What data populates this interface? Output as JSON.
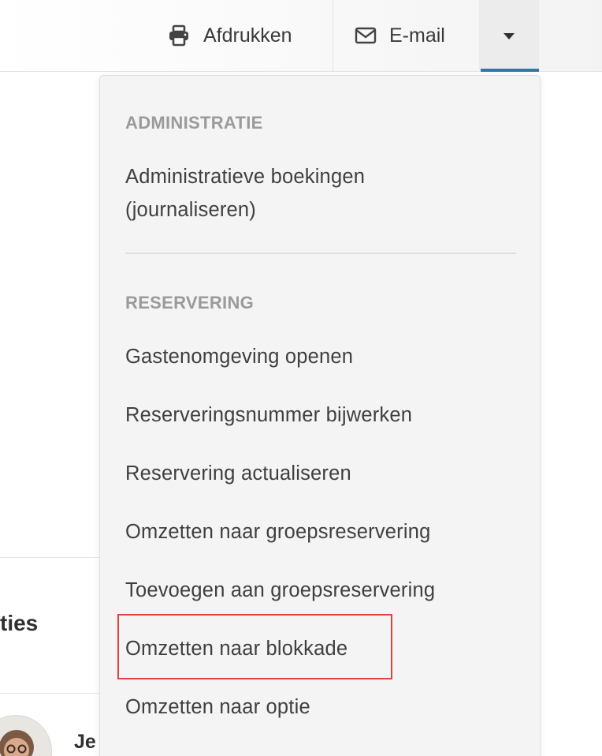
{
  "toolbar": {
    "print_label": "Afdrukken",
    "email_label": "E-mail"
  },
  "background": {
    "heading_fragment": "ties",
    "name_fragment": "Je"
  },
  "menu": {
    "sections": [
      {
        "title": "ADMINISTRATIE",
        "items": [
          {
            "label_line1": "Administratieve boekingen",
            "label_line2": "(journaliseren)"
          }
        ]
      },
      {
        "title": "RESERVERING",
        "items": [
          {
            "label": "Gastenomgeving openen"
          },
          {
            "label": "Reserveringsnummer bijwerken"
          },
          {
            "label": "Reservering actualiseren"
          },
          {
            "label": "Omzetten naar groepsreservering"
          },
          {
            "label": "Toevoegen aan groepsreservering"
          },
          {
            "label": "Omzetten naar blokkade",
            "highlighted": true
          },
          {
            "label": "Omzetten naar optie"
          }
        ]
      }
    ]
  },
  "colors": {
    "accent_underline": "#3178a8",
    "highlight_border": "#d9473a",
    "section_title": "#9a9a9a"
  },
  "icons": {
    "print": "printer-icon",
    "email": "envelope-icon",
    "dropdown": "caret-down-icon"
  }
}
